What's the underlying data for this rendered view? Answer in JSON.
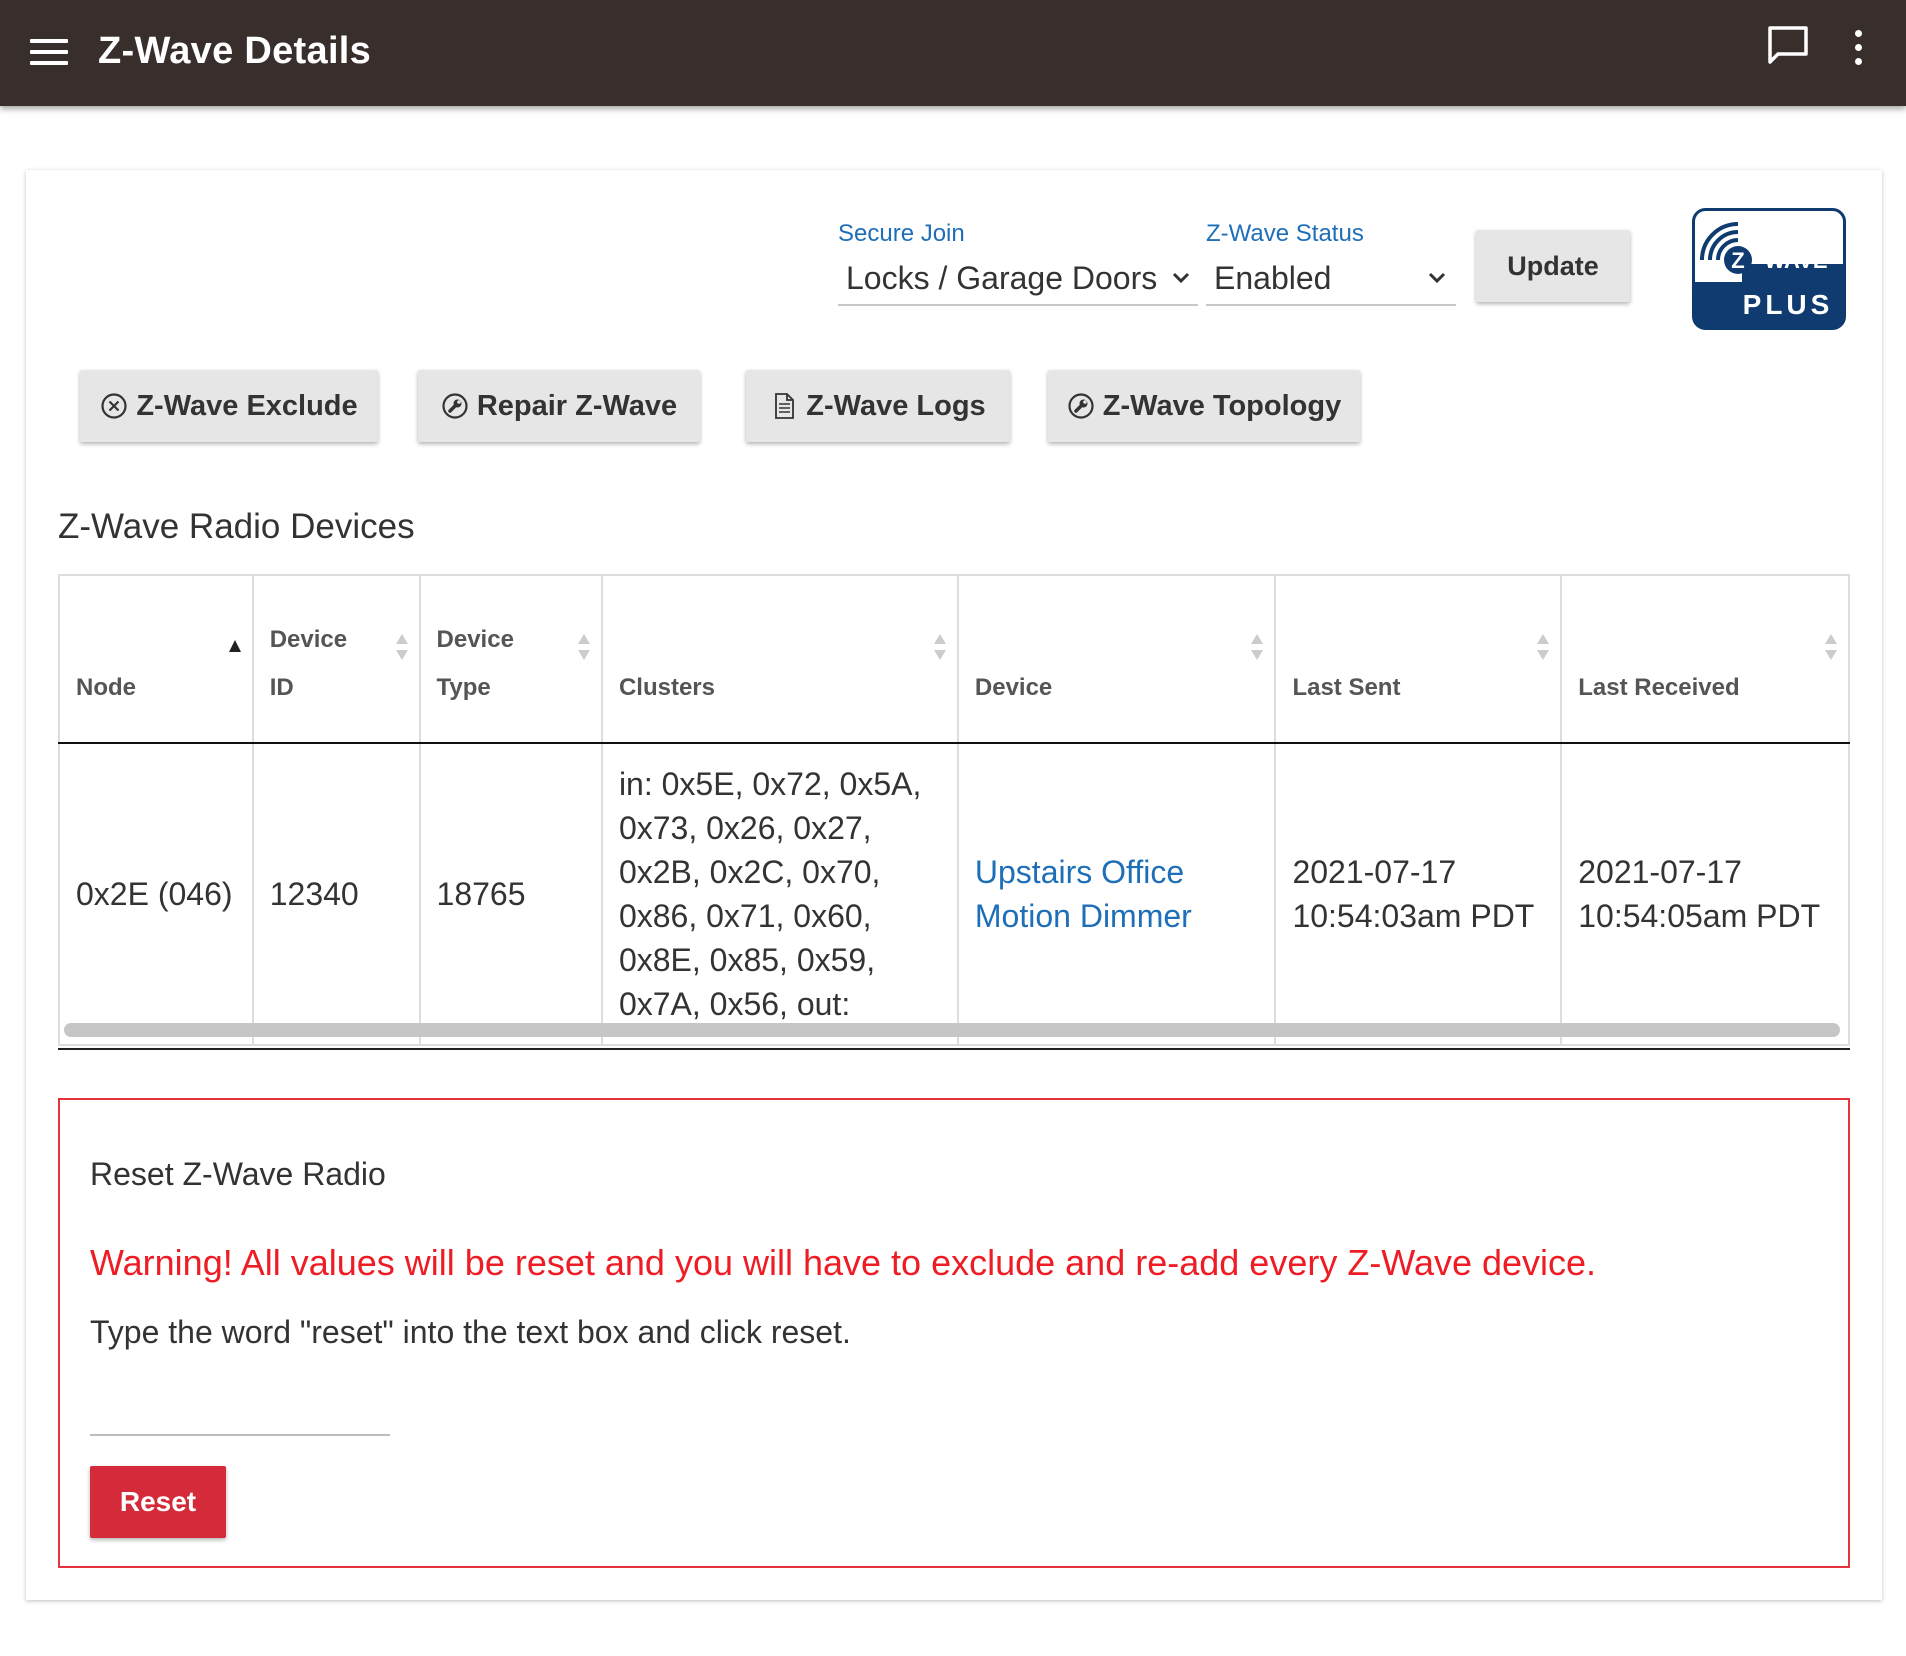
{
  "header": {
    "title": "Z-Wave Details"
  },
  "controls": {
    "secure_join": {
      "label": "Secure Join",
      "value": "Locks / Garage Doors"
    },
    "zwave_status": {
      "label": "Z-Wave Status",
      "value": "Enabled"
    },
    "update_label": "Update"
  },
  "logo": {
    "line1": "WAVE",
    "line2": "PLUS"
  },
  "actions": [
    {
      "label": "Z-Wave Exclude",
      "icon": "circle-x-icon"
    },
    {
      "label": "Repair Z-Wave",
      "icon": "wrench-icon"
    },
    {
      "label": "Z-Wave Logs",
      "icon": "document-icon"
    },
    {
      "label": "Z-Wave Topology",
      "icon": "wrench-icon"
    }
  ],
  "devices": {
    "title": "Z-Wave Radio Devices",
    "columns": [
      {
        "line1": "",
        "line2": "Node"
      },
      {
        "line1": "Device",
        "line2": "ID"
      },
      {
        "line1": "Device",
        "line2": "Type"
      },
      {
        "line1": "",
        "line2": "Clusters"
      },
      {
        "line1": "",
        "line2": "Device"
      },
      {
        "line1": "",
        "line2": "Last Sent"
      },
      {
        "line1": "",
        "line2": "Last Received"
      }
    ],
    "rows": [
      {
        "node": "0x2E (046)",
        "device_id": "12340",
        "device_type": "18765",
        "clusters": "in: 0x5E, 0x72, 0x5A, 0x73, 0x26, 0x27, 0x2B, 0x2C, 0x70, 0x86, 0x71, 0x60, 0x8E, 0x85, 0x59, 0x7A, 0x56, out:",
        "device": "Upstairs Office Motion Dimmer",
        "last_sent": "2021-07-17 10:54:03am PDT",
        "last_received": "2021-07-17 10:54:05am PDT"
      }
    ]
  },
  "reset": {
    "title": "Reset Z-Wave Radio",
    "warning": "Warning! All values will be reset and you will have to exclude and re-add every Z-Wave device.",
    "instruction": "Type the word \"reset\" into the text box and click reset.",
    "input_value": "",
    "button_label": "Reset"
  },
  "colors": {
    "topbar": "#382e2c",
    "accent_blue": "#1e6eb8",
    "warning_red": "#ee1c24",
    "reset_button": "#d42a3a"
  }
}
